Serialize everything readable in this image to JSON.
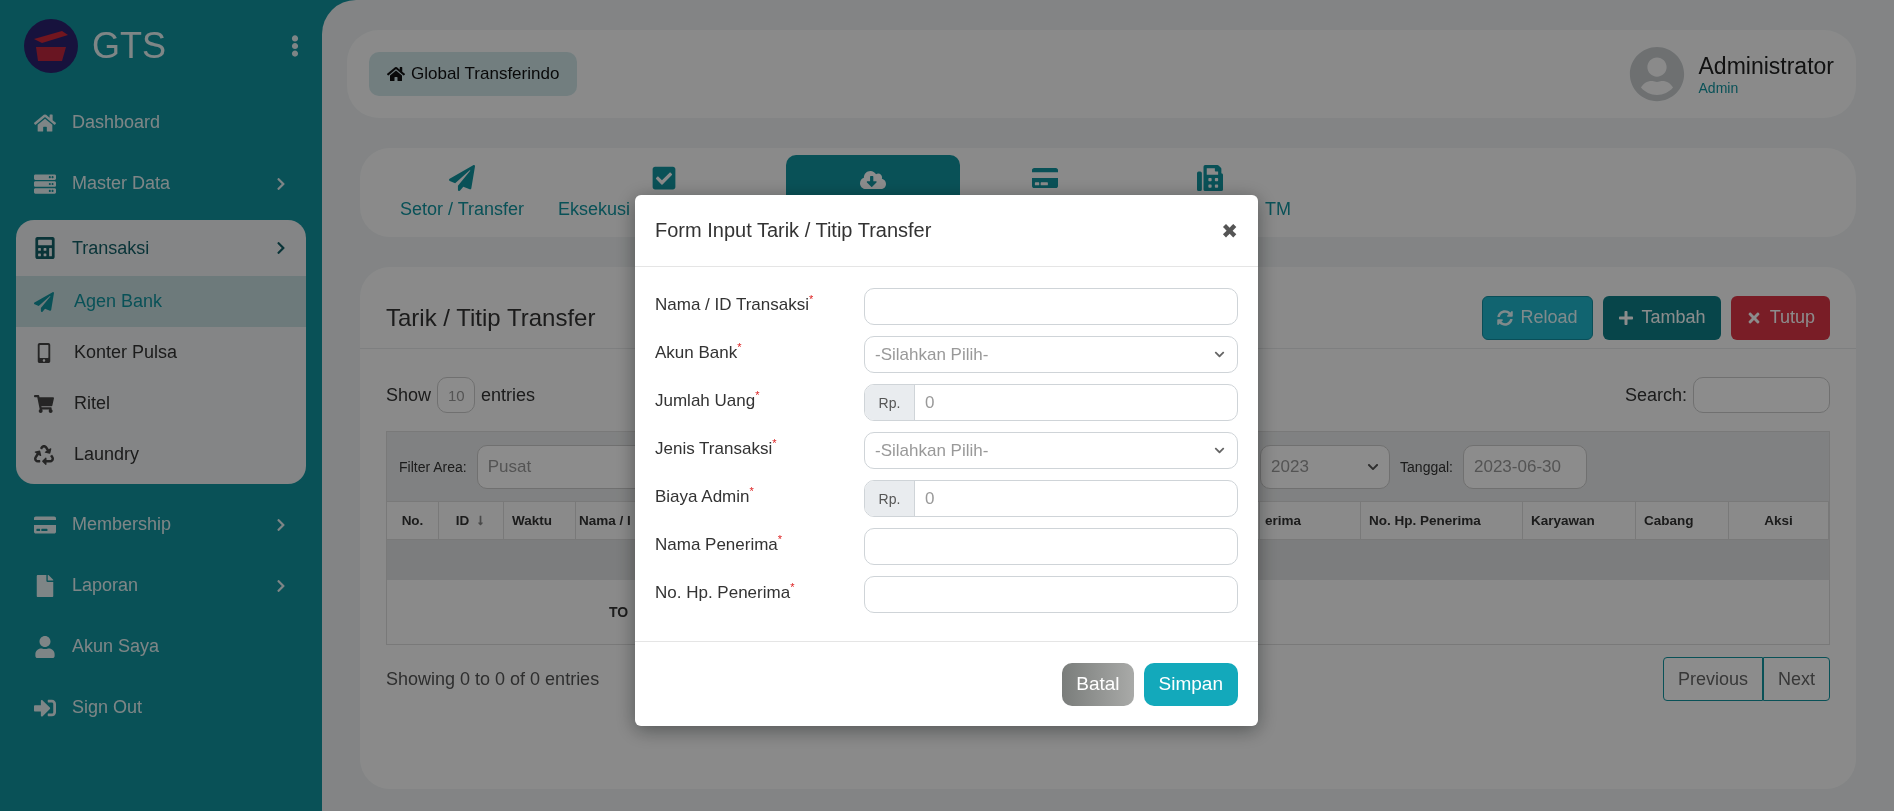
{
  "brand": {
    "name": "GTS"
  },
  "sidebar": {
    "items": [
      {
        "label": "Dashboard",
        "has_chevron": false
      },
      {
        "label": "Master Data",
        "has_chevron": true
      },
      {
        "label": "Transaksi",
        "has_chevron": true,
        "expanded": true,
        "children": [
          {
            "label": "Agen Bank",
            "selected": true
          },
          {
            "label": "Konter Pulsa",
            "selected": false
          },
          {
            "label": "Ritel",
            "selected": false
          },
          {
            "label": "Laundry",
            "selected": false
          }
        ]
      },
      {
        "label": "Membership",
        "has_chevron": true
      },
      {
        "label": "Laporan",
        "has_chevron": true
      },
      {
        "label": "Akun Saya",
        "has_chevron": false
      },
      {
        "label": "Sign Out",
        "has_chevron": false
      }
    ]
  },
  "header": {
    "home_button": "Global Transferindo",
    "user_name": "Administrator",
    "user_role": "Admin"
  },
  "tabs": [
    {
      "label": "Setor / Transfer",
      "selected": false
    },
    {
      "label": "Eksekusi",
      "selected": false
    },
    {
      "selected": true
    },
    {
      "selected": false
    },
    {
      "label": "TM",
      "selected": false
    }
  ],
  "page": {
    "title": "Tarik / Titip Transfer",
    "buttons": [
      {
        "label": "Reload",
        "kind": "reload"
      },
      {
        "label": "Tambah",
        "kind": "add"
      },
      {
        "label": "Tutup",
        "kind": "close"
      }
    ],
    "show_label": "Show",
    "page_size": "10",
    "entries_label": "entries",
    "search_label": "Search:",
    "filter": {
      "area_label": "Filter Area:",
      "area_value": "Pusat",
      "year_value": "2023",
      "date_label": "Tanggal:",
      "date_value": "2023-06-30"
    },
    "columns_left": [
      "No.",
      "ID",
      "Waktu",
      "Nama / I"
    ],
    "columns_right": [
      "erima",
      "No. Hp. Penerima",
      "Karyawan",
      "Cabang",
      "Aksi"
    ],
    "total_label": "TO",
    "info": "Showing 0 to 0 of 0 entries",
    "pager": [
      "Previous",
      "Next"
    ]
  },
  "modal": {
    "title": "Form Input Tarik / Titip Transfer",
    "close": "✖",
    "fields": [
      {
        "label": "Nama / ID Transaksi",
        "required_mark": "*",
        "kind": "text"
      },
      {
        "label": "Akun Bank",
        "required_mark": "*",
        "kind": "select",
        "value": "-Silahkan Pilih-"
      },
      {
        "label": "Jumlah Uang",
        "required_mark": "*",
        "kind": "money",
        "prefix": "Rp.",
        "placeholder": "0"
      },
      {
        "label": "Jenis Transaksi",
        "required_mark": "*",
        "kind": "select",
        "value": "-Silahkan Pilih-"
      },
      {
        "label": "Biaya Admin",
        "required_mark": "*",
        "kind": "money",
        "prefix": "Rp.",
        "placeholder": "0"
      },
      {
        "label": "Nama Penerima",
        "required_mark": "*",
        "kind": "text"
      },
      {
        "label": "No. Hp. Penerima",
        "required_mark": "*",
        "kind": "text"
      }
    ],
    "buttons": [
      {
        "label": "Batal",
        "kind": "cancel"
      },
      {
        "label": "Simpan",
        "kind": "save"
      }
    ]
  }
}
